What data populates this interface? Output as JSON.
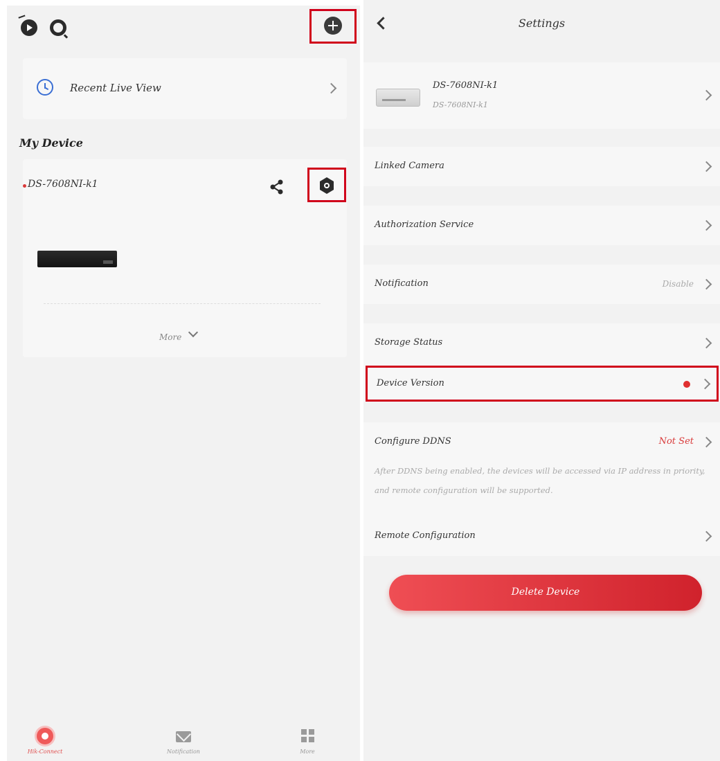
{
  "left": {
    "recent_live_view": "Recent Live View",
    "section_title": "My Device",
    "device": {
      "name": "DS-7608NI-k1",
      "more_label": "More"
    },
    "bottom_nav": [
      {
        "label": "Hik-Connect",
        "icon": "hik-connect-icon"
      },
      {
        "label": "Notification",
        "icon": "mail-icon"
      },
      {
        "label": "More",
        "icon": "grid-icon"
      }
    ]
  },
  "right": {
    "title": "Settings",
    "device_model": "DS-7608NI-k1",
    "device_name": "DS-7608NI-k1",
    "rows": {
      "linked_camera": "Linked Camera",
      "authorization_service": "Authorization Service",
      "notification": {
        "label": "Notification",
        "value": "Disable"
      },
      "storage_status": "Storage Status",
      "device_version": "Device Version",
      "configure_ddns": {
        "label": "Configure DDNS",
        "value": "Not Set"
      },
      "ddns_note": "After DDNS being enabled, the devices will be accessed via IP address in priority, and remote configuration will be supported.",
      "remote_configuration": "Remote Configuration"
    },
    "delete_button": "Delete Device"
  },
  "colors": {
    "accent_red": "#d93a3a",
    "highlight_frame": "#d0021b",
    "clock_blue": "#3b6fd4"
  }
}
